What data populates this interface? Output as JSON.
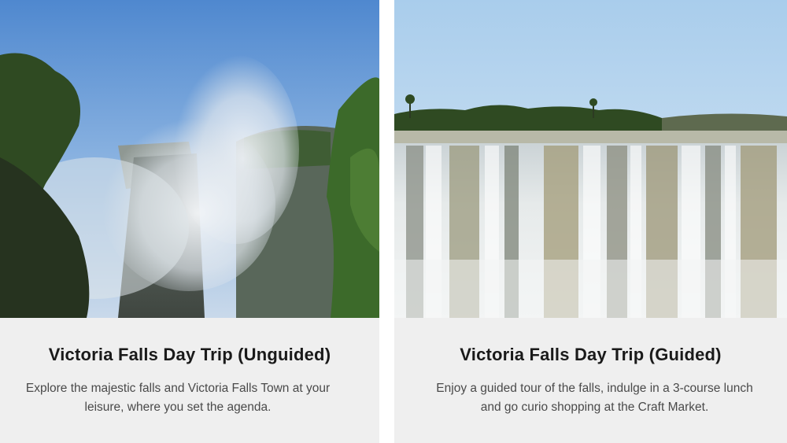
{
  "cards": [
    {
      "title": "Victoria Falls Day Trip (Unguided)",
      "description_line1": "Explore the majestic falls and Victoria Falls Town at your",
      "description_line2": "leisure, where you set the agenda.",
      "image_alt": "Victoria Falls gorge with rising mist"
    },
    {
      "title": "Victoria Falls Day Trip (Guided)",
      "description_line1": "Enjoy a guided tour of the falls, indulge in a 3-course lunch",
      "description_line2": "and go curio shopping at the Craft Market.",
      "image_alt": "Wide curtain of water at Victoria Falls"
    }
  ],
  "colors": {
    "card_background": "#efefef",
    "title": "#1a1a1a",
    "description": "#4a4a4a"
  }
}
